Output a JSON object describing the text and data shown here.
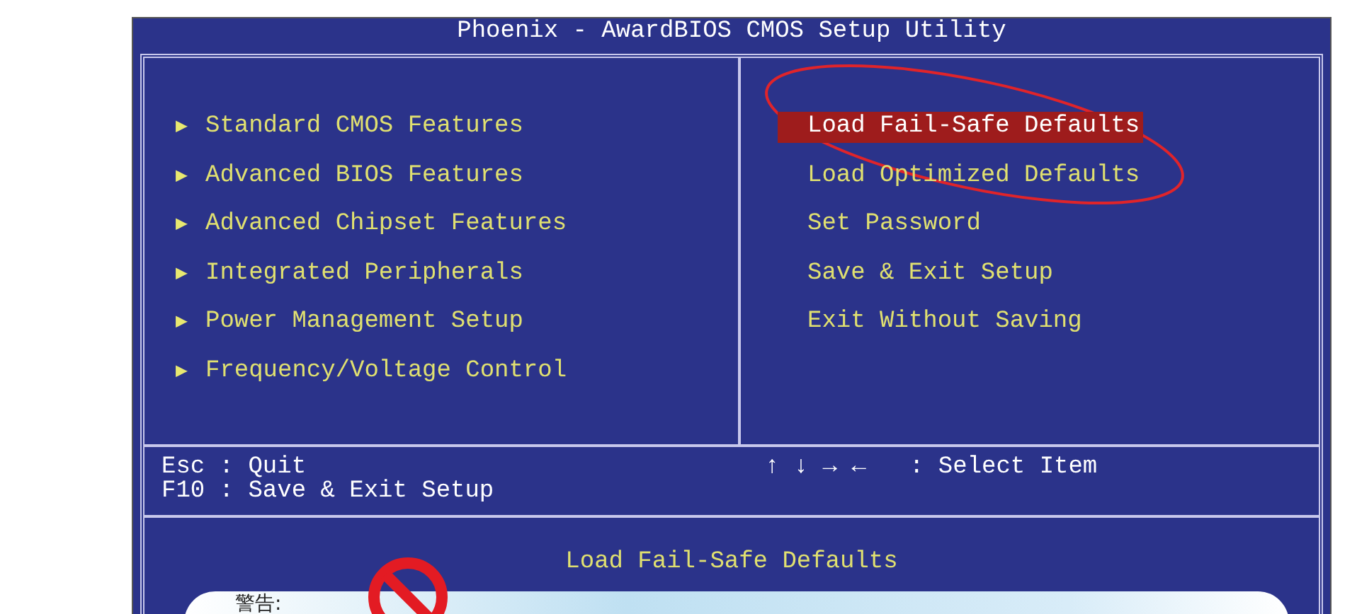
{
  "window": {
    "title": "Phoenix - AwardBIOS CMOS Setup Utility"
  },
  "left_menu": [
    {
      "label": "Standard CMOS Features"
    },
    {
      "label": "Advanced BIOS Features"
    },
    {
      "label": "Advanced Chipset Features"
    },
    {
      "label": "Integrated Peripherals"
    },
    {
      "label": "Power Management Setup"
    },
    {
      "label": "Frequency/Voltage Control"
    }
  ],
  "marker": "▶",
  "right_menu": [
    {
      "label": "Load Fail-Safe Defaults",
      "selected": true
    },
    {
      "label": "Load Optimized Defaults",
      "selected": false
    },
    {
      "label": "Set Password",
      "selected": false
    },
    {
      "label": "Save & Exit Setup",
      "selected": false
    },
    {
      "label": "Exit Without Saving",
      "selected": false
    }
  ],
  "key_help": {
    "left": [
      "Esc : Quit",
      "F10 : Save & Exit Setup"
    ],
    "right": "↑ ↓ → ←   : Select Item"
  },
  "description": "Load Fail-Safe Defaults",
  "dialog": {
    "title": "警告:"
  }
}
